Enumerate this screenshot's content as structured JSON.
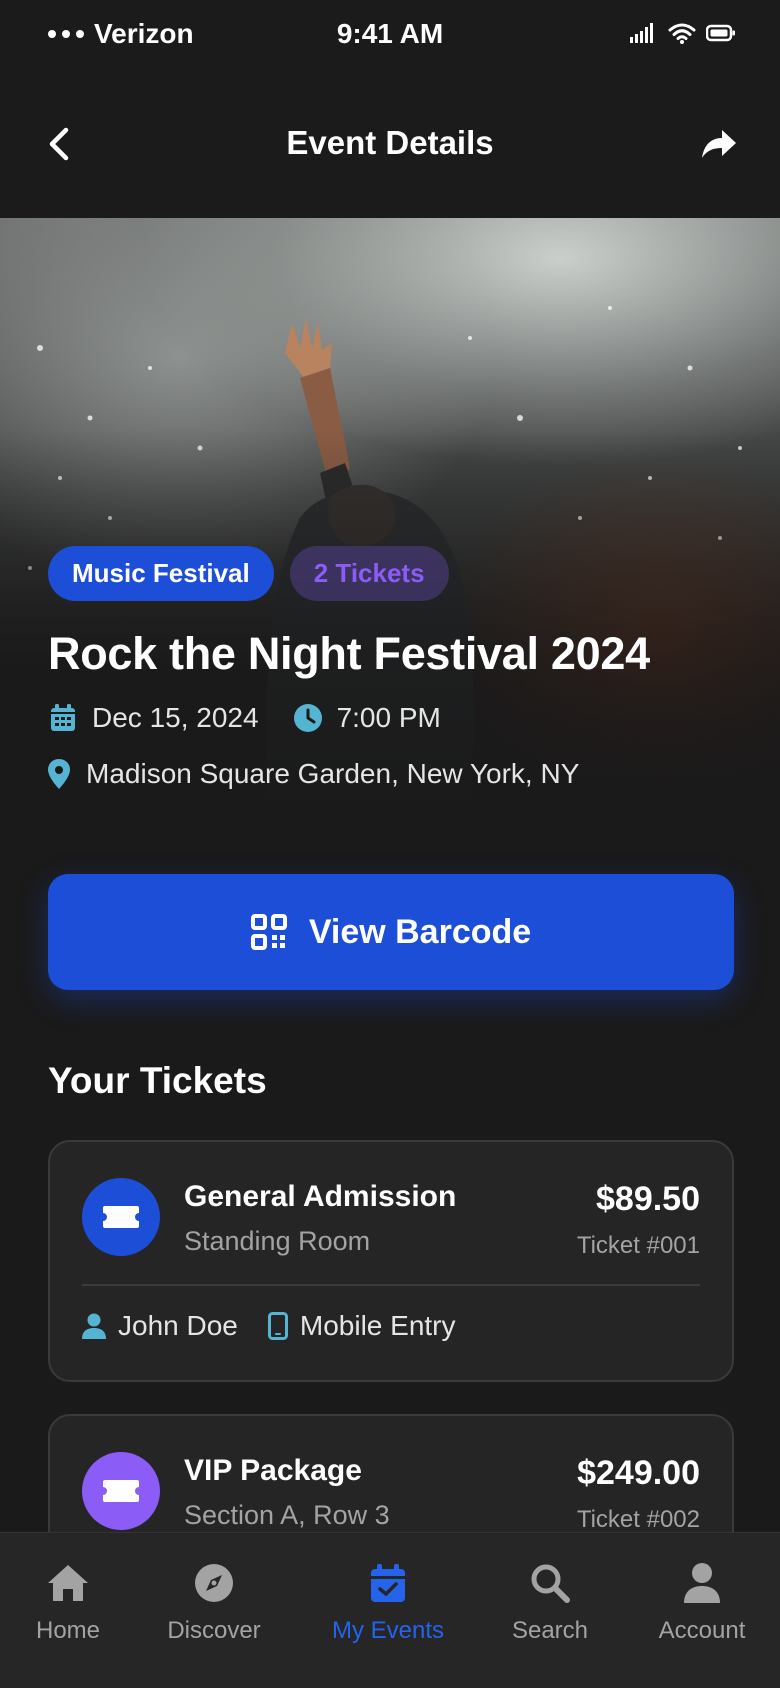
{
  "status_bar": {
    "carrier": "Verizon",
    "time": "9:41 AM"
  },
  "header": {
    "title": "Event Details"
  },
  "event": {
    "category": "Music Festival",
    "ticket_count": "2 Tickets",
    "title": "Rock the Night Festival 2024",
    "date": "Dec 15, 2024",
    "time": "7:00 PM",
    "location": "Madison Square Garden, New York, NY"
  },
  "barcode_button": {
    "label": "View Barcode"
  },
  "tickets_section": {
    "title": "Your Tickets",
    "tickets": [
      {
        "name": "General Admission",
        "subtitle": "Standing Room",
        "price": "$89.50",
        "number": "Ticket #001",
        "holder": "John Doe",
        "delivery": "Mobile Entry",
        "accent": "#1d4ed8"
      },
      {
        "name": "VIP Package",
        "subtitle": "Section A, Row 3",
        "price": "$249.00",
        "number": "Ticket #002",
        "accent": "#8b5cf6"
      }
    ]
  },
  "tabbar": {
    "tabs": [
      {
        "label": "Home",
        "icon": "home-icon"
      },
      {
        "label": "Discover",
        "icon": "compass-icon"
      },
      {
        "label": "My Events",
        "icon": "calendar-check-icon",
        "active": true
      },
      {
        "label": "Search",
        "icon": "search-icon"
      },
      {
        "label": "Account",
        "icon": "user-icon"
      }
    ]
  },
  "colors": {
    "primary": "#1d4ed8",
    "accent_purple": "#8b5cf6",
    "icon_teal": "#56b4d3",
    "background": "#1a1a1a"
  }
}
